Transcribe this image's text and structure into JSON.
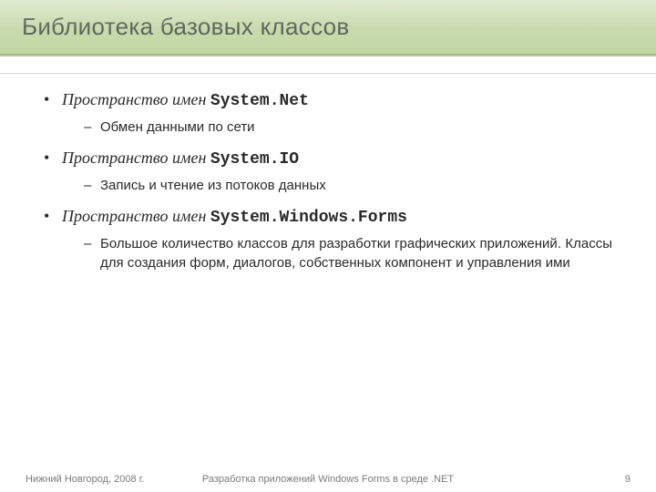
{
  "title": "Библиотека базовых классов",
  "namespaces": [
    {
      "label": "Пространство имен ",
      "code": "System.Net",
      "desc": "Обмен данными по сети",
      "justify": false
    },
    {
      "label": "Пространство имен ",
      "code": "System.IO",
      "desc": "Запись и чтение из потоков данных",
      "justify": false
    },
    {
      "label": "Пространство имен ",
      "code": "System.Windows.Forms",
      "desc": "Большое количество классов для разработки графических приложений. Классы для создания форм, диалогов, собственных компонент и управления ими",
      "justify": true
    }
  ],
  "footer": {
    "left": "Нижний Новгород, 2008 г.",
    "center": "Разработка приложений Windows Forms в среде .NET",
    "page": "9"
  }
}
